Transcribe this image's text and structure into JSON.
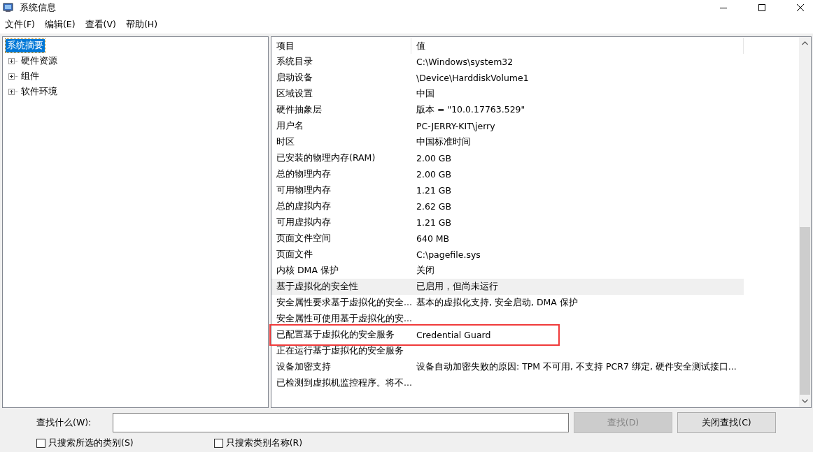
{
  "window": {
    "title": "系统信息"
  },
  "menu": [
    "文件(F)",
    "编辑(E)",
    "查看(V)",
    "帮助(H)"
  ],
  "tree": [
    {
      "label": "系统摘要",
      "selected": true,
      "children": [
        {
          "label": "硬件资源",
          "expanded": false,
          "selected": false
        },
        {
          "label": "组件",
          "expanded": false,
          "selected": false
        },
        {
          "label": "软件环境",
          "expanded": false,
          "selected": false
        }
      ]
    }
  ],
  "table": {
    "columns": [
      "项目",
      "值"
    ],
    "rows": [
      {
        "item": "系统目录",
        "value": "C:\\Windows\\system32",
        "selected": false,
        "marked": false
      },
      {
        "item": "启动设备",
        "value": "\\Device\\HarddiskVolume1",
        "selected": false,
        "marked": false
      },
      {
        "item": "区域设置",
        "value": "中国",
        "selected": false,
        "marked": false
      },
      {
        "item": "硬件抽象层",
        "value": "版本 = \"10.0.17763.529\"",
        "selected": false,
        "marked": false
      },
      {
        "item": "用户名",
        "value": "PC-JERRY-KIT\\jerry",
        "selected": false,
        "marked": false
      },
      {
        "item": "时区",
        "value": "中国标准时间",
        "selected": false,
        "marked": false
      },
      {
        "item": "已安装的物理内存(RAM)",
        "value": "2.00 GB",
        "selected": false,
        "marked": false
      },
      {
        "item": "总的物理内存",
        "value": "2.00 GB",
        "selected": false,
        "marked": false
      },
      {
        "item": "可用物理内存",
        "value": "1.21 GB",
        "selected": false,
        "marked": false
      },
      {
        "item": "总的虚拟内存",
        "value": "2.62 GB",
        "selected": false,
        "marked": false
      },
      {
        "item": "可用虚拟内存",
        "value": "1.21 GB",
        "selected": false,
        "marked": false
      },
      {
        "item": "页面文件空间",
        "value": "640 MB",
        "selected": false,
        "marked": false
      },
      {
        "item": "页面文件",
        "value": "C:\\pagefile.sys",
        "selected": false,
        "marked": false
      },
      {
        "item": "内核 DMA 保护",
        "value": "关闭",
        "selected": false,
        "marked": false
      },
      {
        "item": "基于虚拟化的安全性",
        "value": "已启用，但尚未运行",
        "selected": true,
        "marked": false
      },
      {
        "item": "安全属性要求基于虚拟化的安全...",
        "value": "基本的虚拟化支持, 安全启动, DMA 保护",
        "selected": false,
        "marked": false
      },
      {
        "item": "安全属性可使用基于虚拟化的安...",
        "selected": false,
        "marked": false
      },
      {
        "item": "已配置基于虚拟化的安全服务",
        "value": "Credential Guard",
        "selected": false,
        "marked": true
      },
      {
        "item": "正在运行基于虚拟化的安全服务",
        "selected": false,
        "marked": false
      },
      {
        "item": "设备加密支持",
        "value": "设备自动加密失败的原因: TPM 不可用, 不支持 PCR7 绑定, 硬件安全测试接口...",
        "selected": false,
        "marked": false
      },
      {
        "item": "已检测到虚拟机监控程序。将不...",
        "selected": false,
        "marked": false
      }
    ]
  },
  "find": {
    "label": "查找什么(W):",
    "find_button": {
      "label": "查找(D)",
      "disabled": true
    },
    "close_button": {
      "label": "关闭查找(C)",
      "disabled": false
    },
    "options": [
      {
        "label": "只搜索所选的类别(S)",
        "checked": false
      },
      {
        "label": "只搜索类别名称(R)",
        "checked": false
      }
    ]
  }
}
